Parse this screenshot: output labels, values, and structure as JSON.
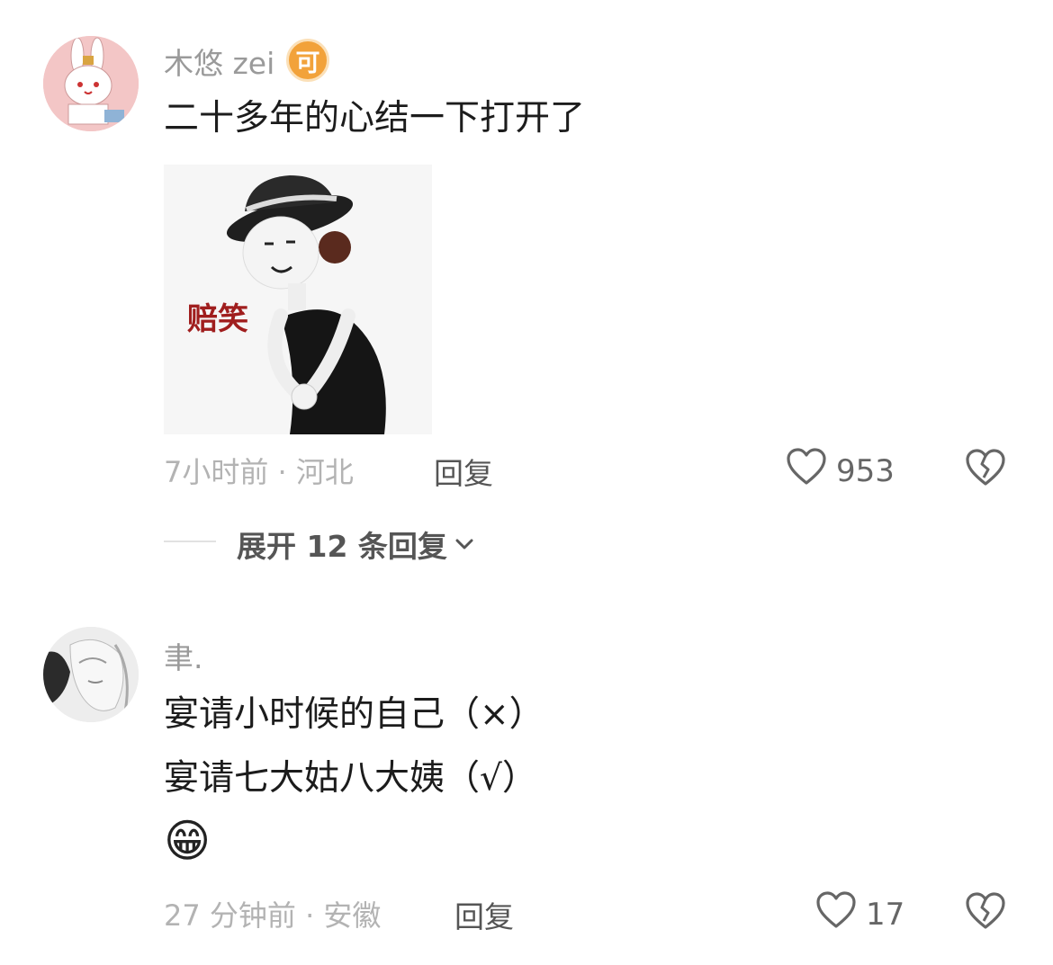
{
  "comments": [
    {
      "username": "木悠 zei",
      "badge": "可",
      "lines": [
        "二十多年的心结一下打开了"
      ],
      "sticker_caption": "赔笑",
      "time_location": "7小时前 · 河北",
      "reply_label": "回复",
      "likes": "953",
      "expand_label": "展开 12 条回复"
    },
    {
      "username": "聿.",
      "lines": [
        "宴请小时候的自己（×）",
        "宴请七大姑八大姨（√）"
      ],
      "emoji": "😁",
      "time_location": "27 分钟前 · 安徽",
      "reply_label": "回复",
      "likes": "17"
    }
  ]
}
